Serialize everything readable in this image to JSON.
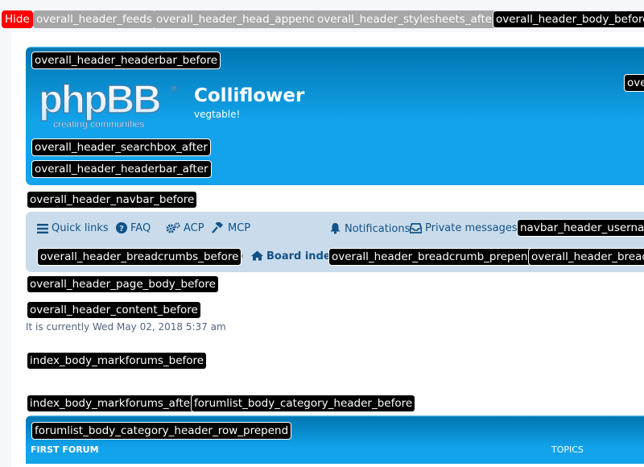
{
  "debug_bar": {
    "hide_label": "Hide",
    "tags": [
      "overall_header_feeds",
      "overall_header_head_append",
      "overall_header_stylesheets_after",
      "overall_header_body_before"
    ]
  },
  "header": {
    "tags": {
      "headerbar_before": "overall_header_headerbar_before",
      "right_cut": "ove",
      "searchbox_after": "overall_header_searchbox_after",
      "headerbar_after": "overall_header_headerbar_after",
      "navbar_before": "overall_header_navbar_before"
    },
    "logo": {
      "main": "phpBB",
      "registered": "®",
      "tagline": "creating communities"
    },
    "site_title": "Colliflower",
    "site_description": "vegtable!"
  },
  "navbar": {
    "quick_links": "Quick links",
    "faq": "FAQ",
    "acp": "ACP",
    "mcp": "MCP",
    "notifications": "Notifications",
    "private_messages": "Private messages",
    "username_tag": "navbar_header_usernam",
    "breadcrumbs_before_tag": "overall_header_breadcrumbs_before",
    "board_index": "Board index",
    "breadcrumb_prepend_tag": "overall_header_breadcrumb_prepend",
    "breadcrumb_right_tag": "overall_header_breadc"
  },
  "page": {
    "page_body_before_tag": "overall_header_page_body_before",
    "content_before_tag": "overall_header_content_before",
    "current_time": "It is currently Wed May 02, 2018 5:37 am",
    "markforums_before_tag": "index_body_markforums_before",
    "markforums_after_tag": "index_body_markforums_after",
    "category_header_before_tag": "forumlist_body_category_header_before",
    "category_header_row_prepend_tag": "forumlist_body_category_header_row_prepend"
  },
  "forumlist": {
    "category_name": "First Forum",
    "topics_header": "Topics"
  },
  "colors": {
    "header_blue": "#12a3eb",
    "navbar_bg": "#cadceb",
    "link": "#105289",
    "tag_bg": "#000000",
    "tag_gray": "#a6a6a6",
    "hide_red": "#ff0000"
  }
}
